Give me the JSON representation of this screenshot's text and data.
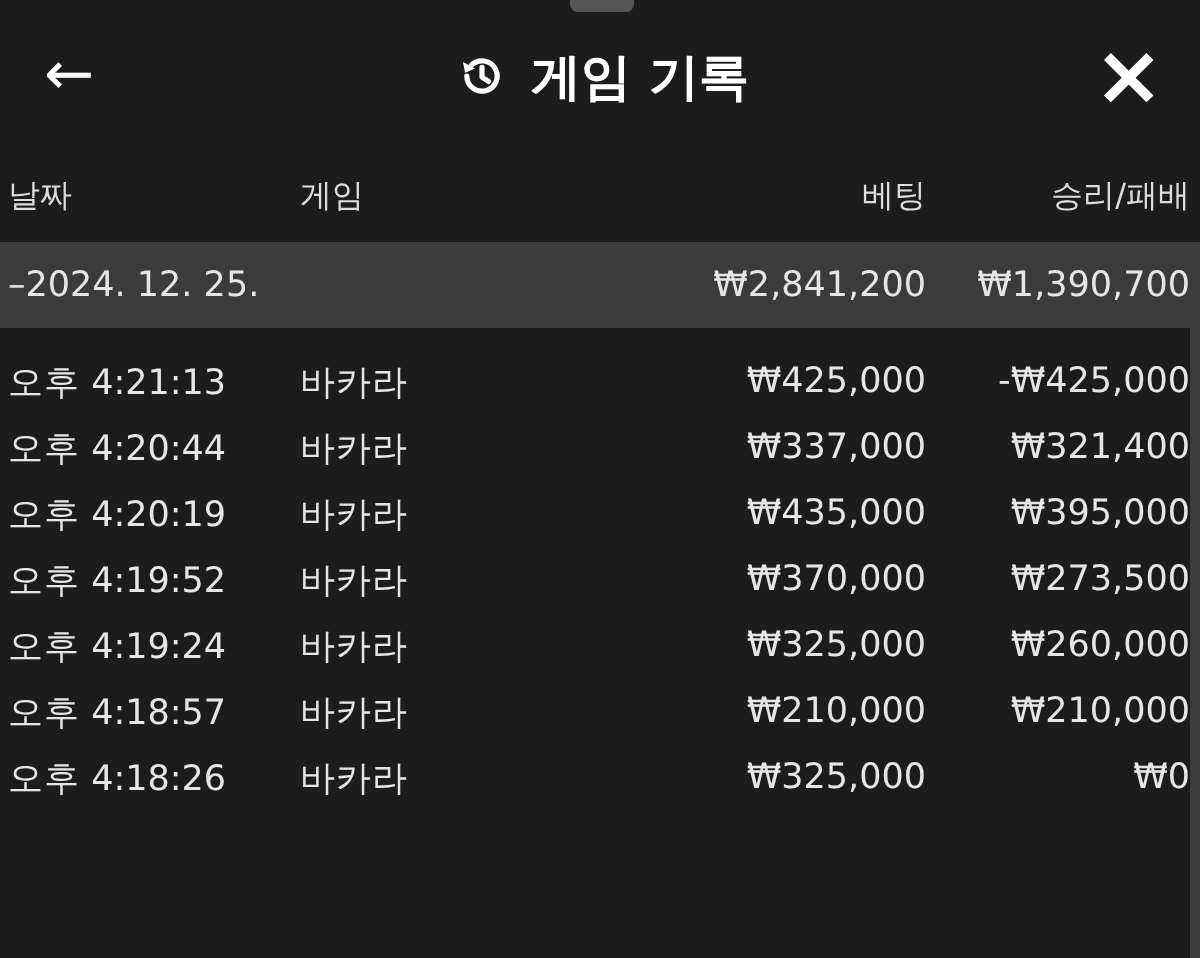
{
  "header": {
    "back": "←",
    "title": "게임 기록",
    "close": "×"
  },
  "table": {
    "columns": [
      "날짜",
      "게임",
      "베팅",
      "승리/패배"
    ],
    "group": {
      "date": "–2024. 12. 25.",
      "bet": "₩2,841,200",
      "result": "₩1,390,700"
    },
    "rows": [
      {
        "time": "오후 4:21:13",
        "game": "바카라",
        "bet": "₩425,000",
        "result": "-₩425,000"
      },
      {
        "time": "오후 4:20:44",
        "game": "바카라",
        "bet": "₩337,000",
        "result": "₩321,400"
      },
      {
        "time": "오후 4:20:19",
        "game": "바카라",
        "bet": "₩435,000",
        "result": "₩395,000"
      },
      {
        "time": "오후 4:19:52",
        "game": "바카라",
        "bet": "₩370,000",
        "result": "₩273,500"
      },
      {
        "time": "오후 4:19:24",
        "game": "바카라",
        "bet": "₩325,000",
        "result": "₩260,000"
      },
      {
        "time": "오후 4:18:57",
        "game": "바카라",
        "bet": "₩210,000",
        "result": "₩210,000"
      },
      {
        "time": "오후 4:18:26",
        "game": "바카라",
        "bet": "₩325,000",
        "result": "₩0"
      }
    ]
  }
}
